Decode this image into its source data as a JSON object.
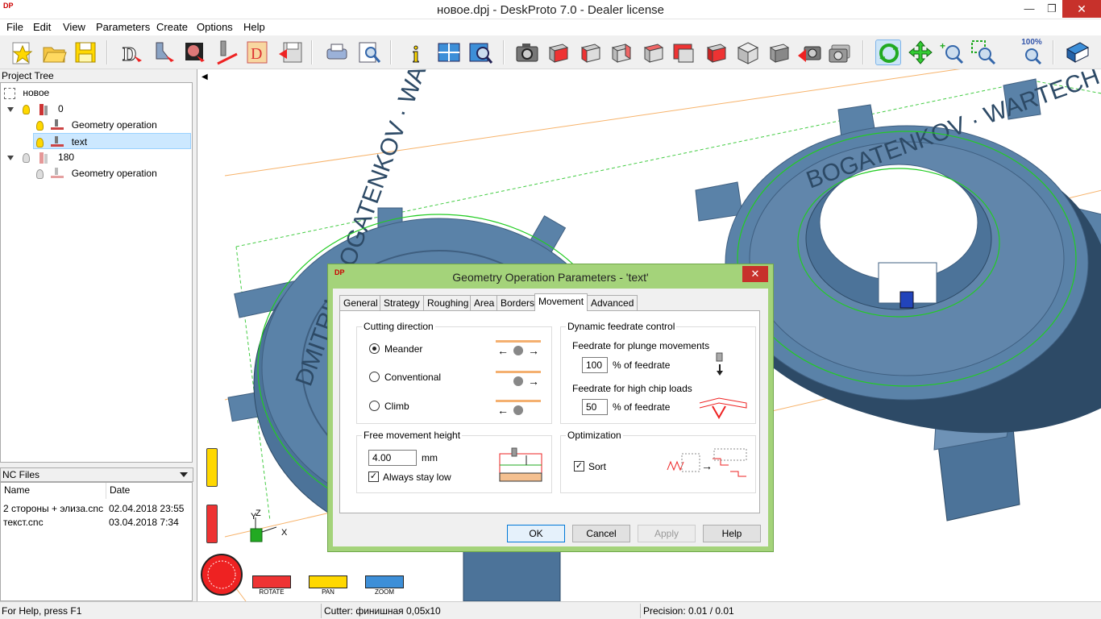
{
  "window": {
    "title": "новое.dpj - DeskProto 7.0 - Dealer license",
    "app_icon_text": "DP",
    "minimize": "—",
    "maximize": "❐",
    "close": "✕"
  },
  "menu": {
    "items": [
      "File",
      "Edit",
      "View",
      "Parameters",
      "Create",
      "Options",
      "Help"
    ]
  },
  "toolbar": {
    "zoom_label": "100%"
  },
  "project_tree": {
    "header": "Project Tree",
    "root": "новое",
    "nodes": [
      {
        "label": "0"
      },
      {
        "label": "Geometry operation"
      },
      {
        "label": "text"
      },
      {
        "label": "180"
      },
      {
        "label": "Geometry operation"
      }
    ]
  },
  "nc_files": {
    "header": "NC Files",
    "columns": [
      "Name",
      "Date"
    ],
    "rows": [
      {
        "name": "2 стороны + элиза.cnc",
        "date": "02.04.2018 23:55"
      },
      {
        "name": "текст.cnc",
        "date": "03.04.2018 7:34"
      }
    ]
  },
  "viewport": {
    "controls": [
      "ROTATE",
      "PAN",
      "ZOOM"
    ],
    "axes": {
      "y": "Y",
      "z": "Z",
      "x": "X"
    },
    "collapse_arrow": "◀"
  },
  "dialog": {
    "title": "Geometry Operation Parameters - 'text'",
    "icon_text": "DP",
    "close": "✕",
    "tabs": [
      "General",
      "Strategy",
      "Roughing",
      "Area",
      "Borders",
      "Movement",
      "Advanced"
    ],
    "active_tab": "Movement",
    "cutting_direction": {
      "label": "Cutting direction",
      "options": [
        "Meander",
        "Conventional",
        "Climb"
      ],
      "selected": "Meander"
    },
    "dynamic_feedrate": {
      "label": "Dynamic feedrate control",
      "plunge_label": "Feedrate for plunge movements",
      "plunge_value": "100",
      "plunge_unit": "% of feedrate",
      "chip_label": "Feedrate for high chip loads",
      "chip_value": "50",
      "chip_unit": "% of feedrate"
    },
    "free_movement": {
      "label": "Free movement height",
      "value": "4.00",
      "unit": "mm",
      "stay_low_label": "Always stay low",
      "stay_low_checked": true
    },
    "optimization": {
      "label": "Optimization",
      "sort_label": "Sort",
      "sort_checked": true
    },
    "buttons": {
      "ok": "OK",
      "cancel": "Cancel",
      "apply": "Apply",
      "help": "Help"
    },
    "check_mark": "✓"
  },
  "status": {
    "help": "For Help, press F1",
    "cutter": "Cutter: финишная 0,05x10",
    "precision": "Precision: 0.01 / 0.01"
  },
  "colors": {
    "part": "#5a82a8",
    "part_dark": "#3f5f80",
    "contour": "#22cc22",
    "accent_frame": "#a4d37a"
  },
  "coin_lettering": {
    "right": "BOGATENKOV · WARTECH · DMITRII",
    "left": "DMITRII · BOGATENKOV · WARTECH"
  }
}
